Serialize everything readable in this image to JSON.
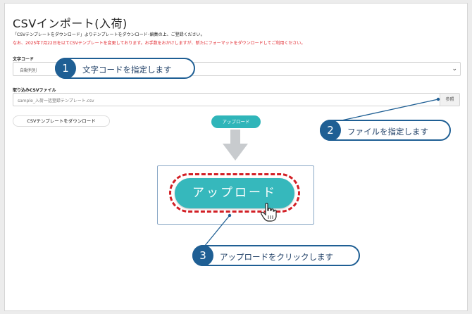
{
  "page": {
    "title": "CSVインポート(入荷)",
    "desc_line1": "「CSVテンプレートをダウンロード」よりテンプレートをダウンロード･編集の上、ご登録ください。",
    "desc_line2": "なお、2025年7月22日を以てCSVテンプレートを変更しております。お手数をおかけしますが、新たにフォーマットをダウンロードしてご利用ください。"
  },
  "encoding": {
    "label": "文字コード",
    "selected": "自動判別"
  },
  "file": {
    "label": "取り込みCSVファイル",
    "value": "sample_入荷一括登録テンプレート.csv",
    "browse_label": "参照"
  },
  "buttons": {
    "download_template": "CSVテンプレートをダウンロード",
    "upload_small": "アップロード",
    "upload_big": "アップロード"
  },
  "callouts": [
    {
      "number": "1",
      "text": "文字コードを指定します"
    },
    {
      "number": "2",
      "text": "ファイルを指定します"
    },
    {
      "number": "3",
      "text": "アップロードをクリックします"
    }
  ],
  "colors": {
    "accent_teal": "#36b8bc",
    "callout_blue": "#1f5f94",
    "highlight_red": "#d21f25",
    "notice_red": "#e0242b"
  },
  "icons": {
    "select_chevron": "chevron-down-icon",
    "down_arrow": "down-arrow-icon",
    "cursor": "hand-pointer-icon"
  }
}
